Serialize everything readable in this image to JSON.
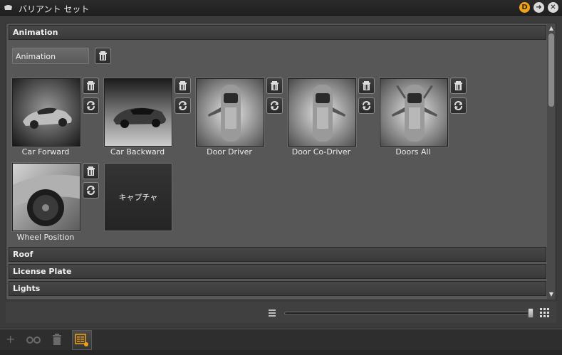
{
  "window": {
    "title": "バリアント セット"
  },
  "sections": {
    "animation": {
      "label": "Animation"
    },
    "roof": {
      "label": "Roof"
    },
    "license_plate": {
      "label": "License Plate"
    },
    "lights": {
      "label": "Lights"
    }
  },
  "animation_field": {
    "value": "Animation"
  },
  "variants": [
    {
      "label": "Car Forward",
      "icon": "car-front-quarter-view"
    },
    {
      "label": "Car Backward",
      "icon": "car-rear-quarter-view"
    },
    {
      "label": "Door Driver",
      "icon": "car-top-view-driver-door-open"
    },
    {
      "label": "Door Co-Driver",
      "icon": "car-top-view-codriver-door-open"
    },
    {
      "label": "Doors All",
      "icon": "car-top-view-all-doors-open"
    },
    {
      "label": "Wheel Position",
      "icon": "car-wheel-closeup"
    }
  ],
  "capture_button": {
    "label": "キャプチャ"
  },
  "zoom": {
    "level": 1.0
  },
  "colors": {
    "accent": "#f0a21a",
    "panel": "#575757",
    "header": "#3e3e3e"
  }
}
